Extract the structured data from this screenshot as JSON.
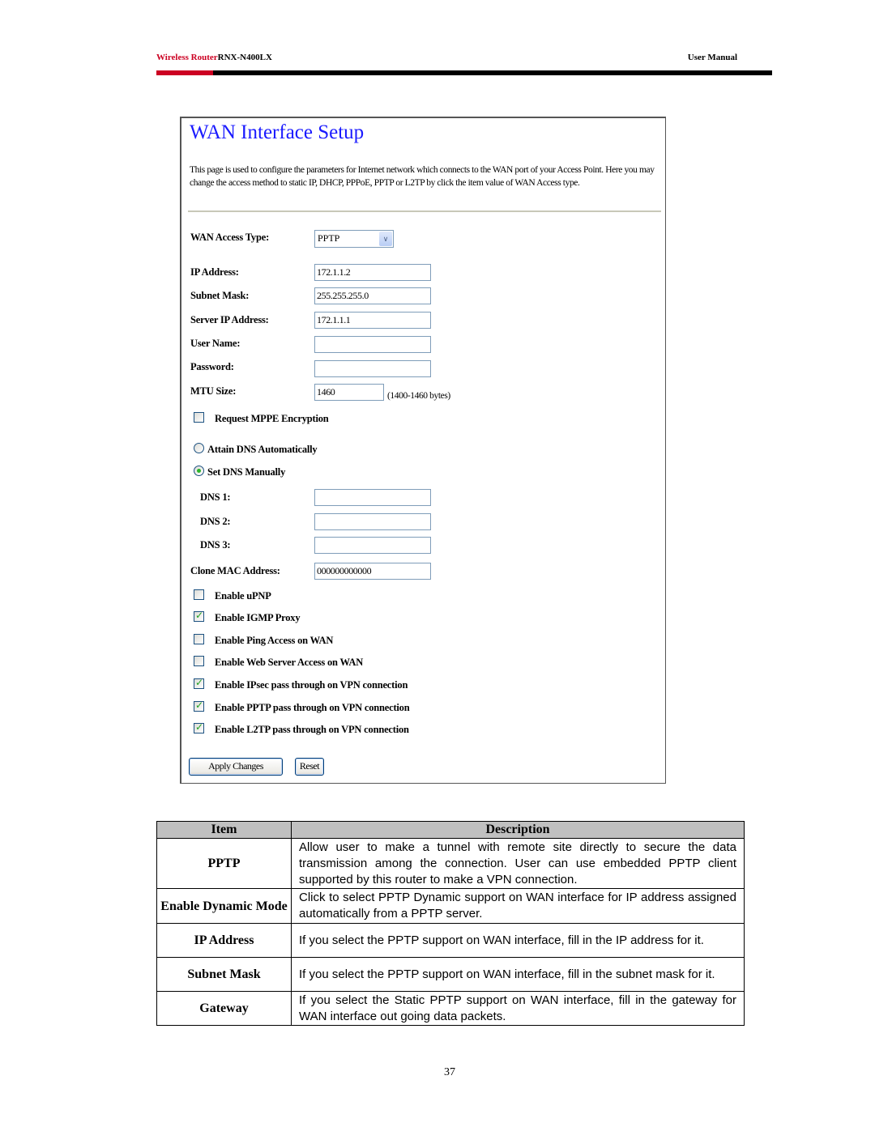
{
  "header": {
    "brand": "Wireless Router",
    "model": "RNX-N400LX",
    "doc_type": "User Manual",
    "colors": {
      "brand": "#cc0022",
      "bar": "#000000"
    }
  },
  "screenshot": {
    "title": "WAN Interface Setup",
    "intro": "This page is used to configure the parameters for Internet network which connects to the WAN port of your Access Point. Here you may change the access method to static IP, DHCP, PPPoE, PPTP or L2TP by click the item value of WAN Access type.",
    "wan_access_type": {
      "label": "WAN Access Type:",
      "value": "PPTP"
    },
    "fields": [
      {
        "label": "IP Address:",
        "value": "172.1.1.2"
      },
      {
        "label": "Subnet Mask:",
        "value": "255.255.255.0"
      },
      {
        "label": "Server IP Address:",
        "value": "172.1.1.1"
      },
      {
        "label": "User Name:",
        "value": ""
      },
      {
        "label": "Password:",
        "value": ""
      }
    ],
    "mtu": {
      "label": "MTU Size:",
      "value": "1460",
      "hint": "(1400-1460 bytes)"
    },
    "mppe": {
      "label": "Request MPPE Encryption",
      "checked": false
    },
    "dns_mode": [
      {
        "label": "Attain DNS Automatically",
        "selected": false
      },
      {
        "label": "Set DNS Manually",
        "selected": true
      }
    ],
    "dns_fields": [
      {
        "label": "DNS 1:",
        "value": ""
      },
      {
        "label": "DNS 2:",
        "value": ""
      },
      {
        "label": "DNS 3:",
        "value": ""
      }
    ],
    "clone_mac": {
      "label": "Clone MAC Address:",
      "value": "000000000000"
    },
    "options": [
      {
        "label": "Enable uPNP",
        "checked": false
      },
      {
        "label": "Enable IGMP Proxy",
        "checked": true
      },
      {
        "label": "Enable Ping Access on WAN",
        "checked": false
      },
      {
        "label": "Enable Web Server Access on WAN",
        "checked": false
      },
      {
        "label": "Enable IPsec pass through on VPN connection",
        "checked": true
      },
      {
        "label": "Enable PPTP pass through on VPN connection",
        "checked": true
      },
      {
        "label": "Enable L2TP pass through on VPN connection",
        "checked": true
      }
    ],
    "buttons": {
      "apply": "Apply Changes",
      "reset": "Reset"
    },
    "colors": {
      "title": "#1a1aff",
      "input_border": "#7f9db9",
      "check": "#21a121"
    }
  },
  "table": {
    "headers": {
      "item": "Item",
      "description": "Description"
    },
    "rows": [
      {
        "item": "PPTP",
        "description": "Allow user to make a tunnel with remote site directly to secure the data transmission among the connection. User can use embedded PPTP client supported by this router to make a VPN connection."
      },
      {
        "item": "Enable Dynamic Mode",
        "description": "Click to select PPTP Dynamic support on WAN interface for IP address assigned automatically from a PPTP server."
      },
      {
        "item": "IP Address",
        "description": "If you select the PPTP support on WAN interface, fill in the IP address for it."
      },
      {
        "item": "Subnet Mask",
        "description": "If you select the PPTP support on WAN interface, fill in the subnet mask for it."
      },
      {
        "item": "Gateway",
        "description": "If you select the Static PPTP support on WAN interface, fill in the gateway for WAN interface out going data packets."
      }
    ],
    "header_bg": "#c0c0c0"
  },
  "footer": {
    "page_number": "37"
  }
}
